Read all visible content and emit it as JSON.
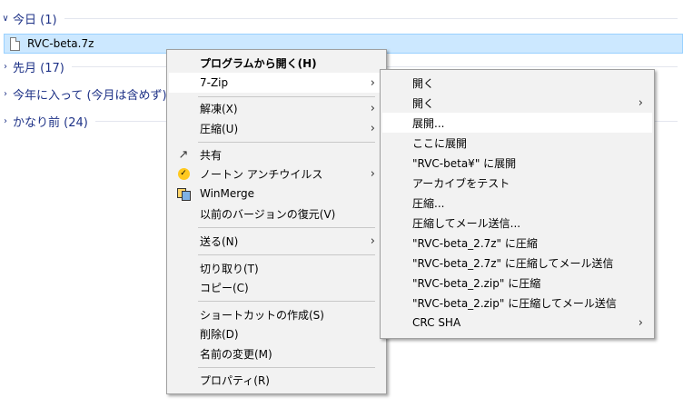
{
  "groups": {
    "today": "今日 (1)",
    "last_month": "先月 (17)",
    "this_year": "今年に入って (今月は含めず) (",
    "long_ago": "かなり前 (24)"
  },
  "file": {
    "name": "RVC-beta.7z"
  },
  "main_menu": {
    "open_with": "プログラムから開く(H)",
    "sevenzip": "7-Zip",
    "extract": "解凍(X)",
    "compress": "圧縮(U)",
    "share": "共有",
    "norton": "ノートン アンチウイルス",
    "winmerge": "WinMerge",
    "restore_previous": "以前のバージョンの復元(V)",
    "send_to": "送る(N)",
    "cut": "切り取り(T)",
    "copy": "コピー(C)",
    "create_shortcut": "ショートカットの作成(S)",
    "delete": "削除(D)",
    "rename": "名前の変更(M)",
    "properties": "プロパティ(R)"
  },
  "submenu": {
    "items": [
      "開く",
      "開く",
      "展開...",
      "ここに展開",
      "\"RVC-beta¥\" に展開",
      "アーカイブをテスト",
      "圧縮...",
      "圧縮してメール送信...",
      "\"RVC-beta_2.7z\" に圧縮",
      "\"RVC-beta_2.7z\" に圧縮してメール送信",
      "\"RVC-beta_2.zip\" に圧縮",
      "\"RVC-beta_2.zip\" に圧縮してメール送信",
      "CRC SHA"
    ]
  },
  "icons": {
    "chevron": "chevron-down-icon",
    "submenu_arrow": "chevron-right-icon"
  },
  "colors": {
    "group_text": "#1e3287",
    "selection_bg": "#cce8ff",
    "menu_bg": "#f2f2f2",
    "norton_yellow": "#ffc91f"
  }
}
